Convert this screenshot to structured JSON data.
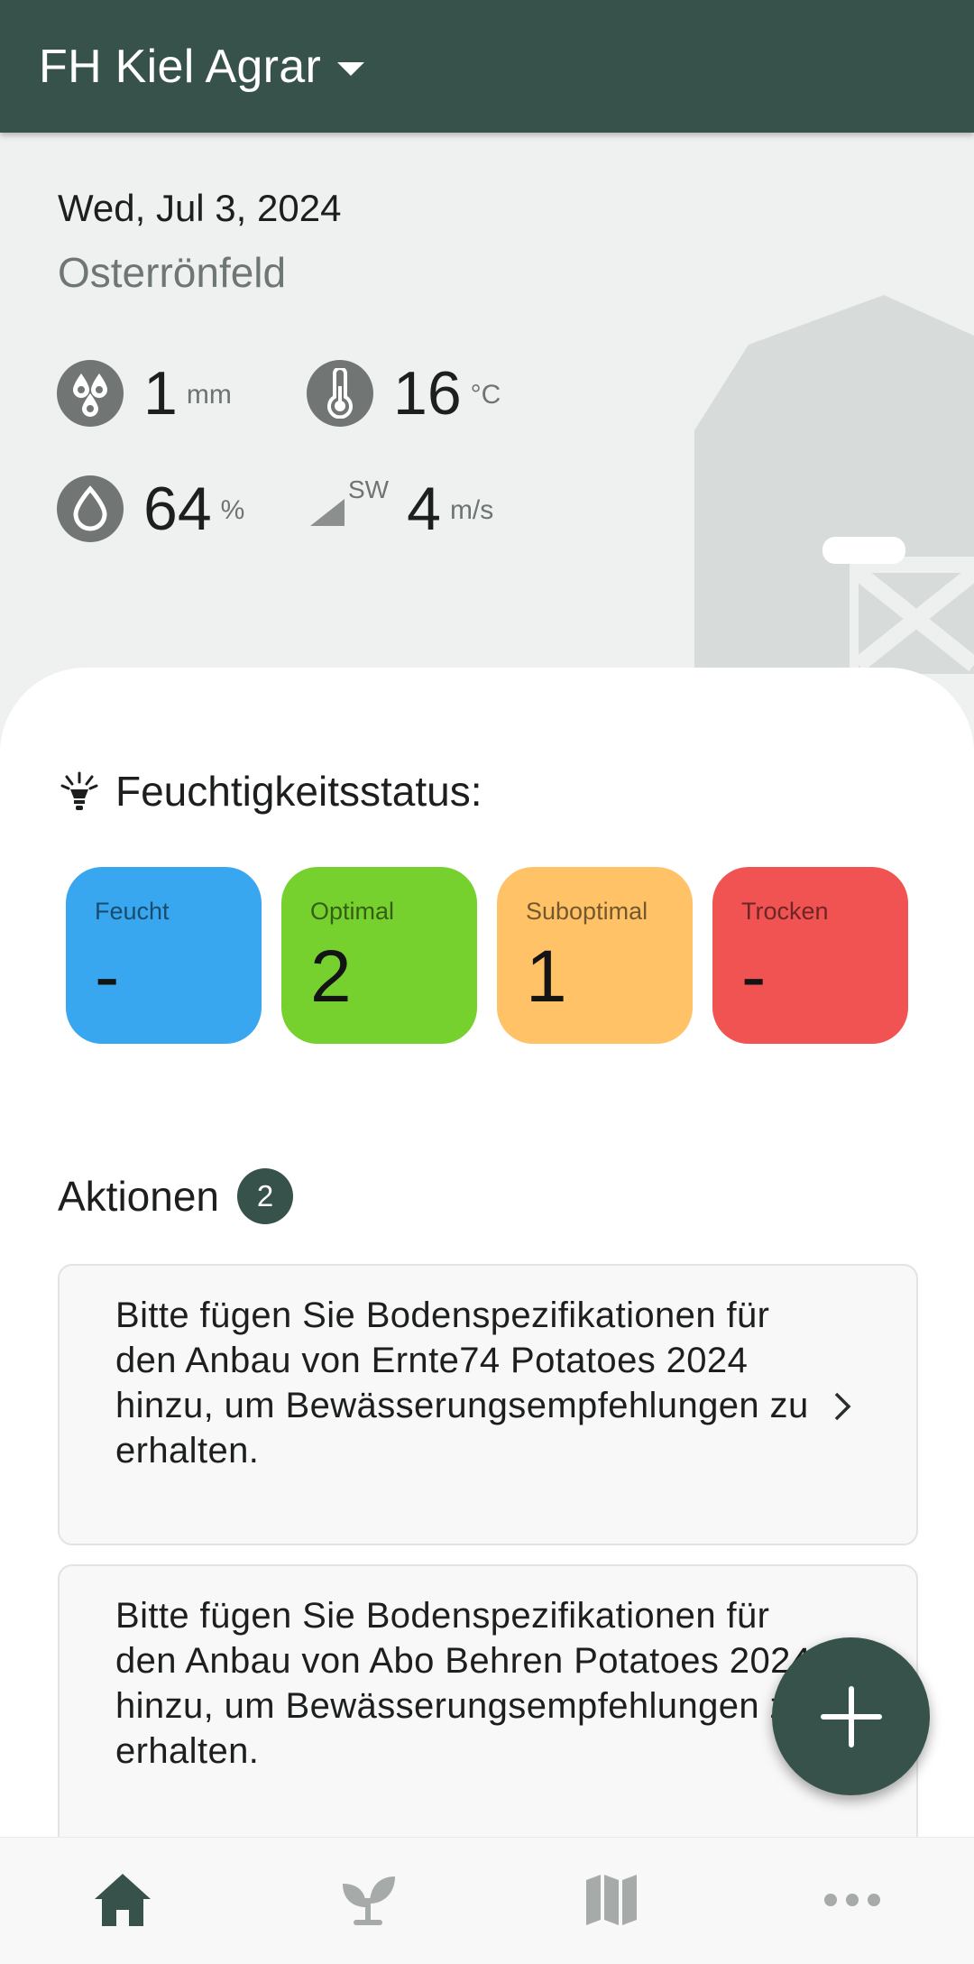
{
  "app_bar": {
    "title": "FH Kiel Agrar"
  },
  "weather": {
    "date": "Wed, Jul 3, 2024",
    "location": "Osterrönfeld",
    "precipitation": {
      "value": "1",
      "unit": "mm"
    },
    "temperature": {
      "value": "16",
      "unit": "°C"
    },
    "humidity": {
      "value": "64",
      "unit": "%"
    },
    "wind": {
      "direction": "SW",
      "value": "4",
      "unit": "m/s"
    }
  },
  "moisture": {
    "title": "Feuchtigkeitsstatus:",
    "tiles": [
      {
        "label": "Feucht",
        "value": "-",
        "color": "#39a7f0"
      },
      {
        "label": "Optimal",
        "value": "2",
        "color": "#76d12f"
      },
      {
        "label": "Suboptimal",
        "value": "1",
        "color": "#ffc267"
      },
      {
        "label": "Trocken",
        "value": "-",
        "color": "#f15353"
      }
    ]
  },
  "actions": {
    "title": "Aktionen",
    "count": "2",
    "items": [
      {
        "text": "Bitte fügen Sie Bodenspezifikationen für den Anbau von Ernte74 Potatoes 2024 hinzu, um Bewässerungsempfehlungen zu erhalten."
      },
      {
        "text": "Bitte fügen Sie Bodenspezifikationen für den Anbau von Abo Behren Potatoes 2024 hinzu, um Bewässerungsempfehlungen zu erhalten."
      }
    ]
  },
  "bottom_nav": {
    "items": [
      {
        "icon": "home-icon",
        "active": true
      },
      {
        "icon": "sprout-icon",
        "active": false
      },
      {
        "icon": "map-icon",
        "active": false
      },
      {
        "icon": "more-icon",
        "active": false
      }
    ]
  },
  "colors": {
    "primary": "#36524a",
    "background": "#eff1f0"
  }
}
